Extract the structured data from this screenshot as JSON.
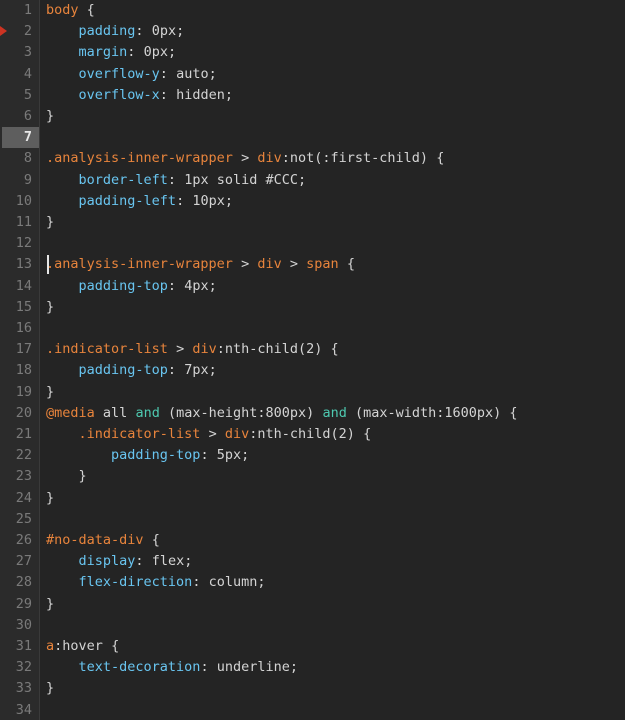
{
  "editor": {
    "language": "CSS",
    "theme": "dark",
    "colors": {
      "background": "#242424",
      "gutter_background": "#2B2B2B",
      "line_number": "#7A7A7A",
      "active_line_number": "#E8E8E8",
      "active_line_highlight": "#5E5E5E",
      "selector": "#E8843C",
      "property": "#69C5F0",
      "value": "#D4D4D4",
      "keyword": "#4EC9B0",
      "breakpoint_marker": "#CC3322",
      "cursor": "#E6E6E6"
    },
    "cursor": {
      "line": 7,
      "column": 1
    },
    "breakpoint_marker_line": 2,
    "total_lines": 34,
    "first_visible_line": 1,
    "lines": [
      {
        "n": 1,
        "tokens": [
          {
            "t": "sel",
            "v": "body"
          },
          {
            "t": "plain",
            "v": " "
          },
          {
            "t": "punc",
            "v": "{"
          }
        ]
      },
      {
        "n": 2,
        "tokens": [
          {
            "t": "plain",
            "v": "    "
          },
          {
            "t": "prop",
            "v": "padding"
          },
          {
            "t": "punc",
            "v": ":"
          },
          {
            "t": "plain",
            "v": " "
          },
          {
            "t": "val",
            "v": "0px"
          },
          {
            "t": "punc",
            "v": ";"
          }
        ]
      },
      {
        "n": 3,
        "tokens": [
          {
            "t": "plain",
            "v": "    "
          },
          {
            "t": "prop",
            "v": "margin"
          },
          {
            "t": "punc",
            "v": ":"
          },
          {
            "t": "plain",
            "v": " "
          },
          {
            "t": "val",
            "v": "0px"
          },
          {
            "t": "punc",
            "v": ";"
          }
        ]
      },
      {
        "n": 4,
        "tokens": [
          {
            "t": "plain",
            "v": "    "
          },
          {
            "t": "prop",
            "v": "overflow-y"
          },
          {
            "t": "punc",
            "v": ":"
          },
          {
            "t": "plain",
            "v": " "
          },
          {
            "t": "val",
            "v": "auto"
          },
          {
            "t": "punc",
            "v": ";"
          }
        ]
      },
      {
        "n": 5,
        "tokens": [
          {
            "t": "plain",
            "v": "    "
          },
          {
            "t": "prop",
            "v": "overflow-x"
          },
          {
            "t": "punc",
            "v": ":"
          },
          {
            "t": "plain",
            "v": " "
          },
          {
            "t": "val",
            "v": "hidden"
          },
          {
            "t": "punc",
            "v": ";"
          }
        ]
      },
      {
        "n": 6,
        "tokens": [
          {
            "t": "punc",
            "v": "}"
          }
        ]
      },
      {
        "n": 7,
        "tokens": []
      },
      {
        "n": 8,
        "tokens": [
          {
            "t": "sel",
            "v": ".analysis-inner-wrapper"
          },
          {
            "t": "plain",
            "v": " "
          },
          {
            "t": "comb",
            "v": ">"
          },
          {
            "t": "plain",
            "v": " "
          },
          {
            "t": "sel",
            "v": "div"
          },
          {
            "t": "pseudo",
            "v": ":not(:first-child)"
          },
          {
            "t": "plain",
            "v": " "
          },
          {
            "t": "punc",
            "v": "{"
          }
        ]
      },
      {
        "n": 9,
        "tokens": [
          {
            "t": "plain",
            "v": "    "
          },
          {
            "t": "prop",
            "v": "border-left"
          },
          {
            "t": "punc",
            "v": ":"
          },
          {
            "t": "plain",
            "v": " "
          },
          {
            "t": "val",
            "v": "1px solid #CCC"
          },
          {
            "t": "punc",
            "v": ";"
          }
        ]
      },
      {
        "n": 10,
        "tokens": [
          {
            "t": "plain",
            "v": "    "
          },
          {
            "t": "prop",
            "v": "padding-left"
          },
          {
            "t": "punc",
            "v": ":"
          },
          {
            "t": "plain",
            "v": " "
          },
          {
            "t": "val",
            "v": "10px"
          },
          {
            "t": "punc",
            "v": ";"
          }
        ]
      },
      {
        "n": 11,
        "tokens": [
          {
            "t": "punc",
            "v": "}"
          }
        ]
      },
      {
        "n": 12,
        "tokens": []
      },
      {
        "n": 13,
        "tokens": [
          {
            "t": "sel",
            "v": ".analysis-inner-wrapper"
          },
          {
            "t": "plain",
            "v": " "
          },
          {
            "t": "comb",
            "v": ">"
          },
          {
            "t": "plain",
            "v": " "
          },
          {
            "t": "sel",
            "v": "div"
          },
          {
            "t": "plain",
            "v": " "
          },
          {
            "t": "comb",
            "v": ">"
          },
          {
            "t": "plain",
            "v": " "
          },
          {
            "t": "sel",
            "v": "span"
          },
          {
            "t": "plain",
            "v": " "
          },
          {
            "t": "punc",
            "v": "{"
          }
        ]
      },
      {
        "n": 14,
        "tokens": [
          {
            "t": "plain",
            "v": "    "
          },
          {
            "t": "prop",
            "v": "padding-top"
          },
          {
            "t": "punc",
            "v": ":"
          },
          {
            "t": "plain",
            "v": " "
          },
          {
            "t": "val",
            "v": "4px"
          },
          {
            "t": "punc",
            "v": ";"
          }
        ]
      },
      {
        "n": 15,
        "tokens": [
          {
            "t": "punc",
            "v": "}"
          }
        ]
      },
      {
        "n": 16,
        "tokens": []
      },
      {
        "n": 17,
        "tokens": [
          {
            "t": "sel",
            "v": ".indicator-list"
          },
          {
            "t": "plain",
            "v": " "
          },
          {
            "t": "comb",
            "v": ">"
          },
          {
            "t": "plain",
            "v": " "
          },
          {
            "t": "sel",
            "v": "div"
          },
          {
            "t": "pseudo",
            "v": ":nth-child(2)"
          },
          {
            "t": "plain",
            "v": " "
          },
          {
            "t": "punc",
            "v": "{"
          }
        ]
      },
      {
        "n": 18,
        "tokens": [
          {
            "t": "plain",
            "v": "    "
          },
          {
            "t": "prop",
            "v": "padding-top"
          },
          {
            "t": "punc",
            "v": ":"
          },
          {
            "t": "plain",
            "v": " "
          },
          {
            "t": "val",
            "v": "7px"
          },
          {
            "t": "punc",
            "v": ";"
          }
        ]
      },
      {
        "n": 19,
        "tokens": [
          {
            "t": "punc",
            "v": "}"
          }
        ]
      },
      {
        "n": 20,
        "tokens": [
          {
            "t": "sel",
            "v": "@media"
          },
          {
            "t": "plain",
            "v": " "
          },
          {
            "t": "val",
            "v": "all"
          },
          {
            "t": "plain",
            "v": " "
          },
          {
            "t": "kw",
            "v": "and"
          },
          {
            "t": "plain",
            "v": " "
          },
          {
            "t": "val",
            "v": "(max-height:800px)"
          },
          {
            "t": "plain",
            "v": " "
          },
          {
            "t": "kw",
            "v": "and"
          },
          {
            "t": "plain",
            "v": " "
          },
          {
            "t": "val",
            "v": "(max-width:1600px)"
          },
          {
            "t": "plain",
            "v": " "
          },
          {
            "t": "punc",
            "v": "{"
          }
        ]
      },
      {
        "n": 21,
        "tokens": [
          {
            "t": "plain",
            "v": "    "
          },
          {
            "t": "sel",
            "v": ".indicator-list"
          },
          {
            "t": "plain",
            "v": " "
          },
          {
            "t": "comb",
            "v": ">"
          },
          {
            "t": "plain",
            "v": " "
          },
          {
            "t": "sel",
            "v": "div"
          },
          {
            "t": "pseudo",
            "v": ":nth-child(2)"
          },
          {
            "t": "plain",
            "v": " "
          },
          {
            "t": "punc",
            "v": "{"
          }
        ]
      },
      {
        "n": 22,
        "tokens": [
          {
            "t": "plain",
            "v": "        "
          },
          {
            "t": "prop",
            "v": "padding-top"
          },
          {
            "t": "punc",
            "v": ":"
          },
          {
            "t": "plain",
            "v": " "
          },
          {
            "t": "val",
            "v": "5px"
          },
          {
            "t": "punc",
            "v": ";"
          }
        ]
      },
      {
        "n": 23,
        "tokens": [
          {
            "t": "plain",
            "v": "    "
          },
          {
            "t": "punc",
            "v": "}"
          }
        ]
      },
      {
        "n": 24,
        "tokens": [
          {
            "t": "punc",
            "v": "}"
          }
        ]
      },
      {
        "n": 25,
        "tokens": []
      },
      {
        "n": 26,
        "tokens": [
          {
            "t": "sel",
            "v": "#no-data-div"
          },
          {
            "t": "plain",
            "v": " "
          },
          {
            "t": "punc",
            "v": "{"
          }
        ]
      },
      {
        "n": 27,
        "tokens": [
          {
            "t": "plain",
            "v": "    "
          },
          {
            "t": "prop",
            "v": "display"
          },
          {
            "t": "punc",
            "v": ":"
          },
          {
            "t": "plain",
            "v": " "
          },
          {
            "t": "val",
            "v": "flex"
          },
          {
            "t": "punc",
            "v": ";"
          }
        ]
      },
      {
        "n": 28,
        "tokens": [
          {
            "t": "plain",
            "v": "    "
          },
          {
            "t": "prop",
            "v": "flex-direction"
          },
          {
            "t": "punc",
            "v": ":"
          },
          {
            "t": "plain",
            "v": " "
          },
          {
            "t": "val",
            "v": "column"
          },
          {
            "t": "punc",
            "v": ";"
          }
        ]
      },
      {
        "n": 29,
        "tokens": [
          {
            "t": "punc",
            "v": "}"
          }
        ]
      },
      {
        "n": 30,
        "tokens": []
      },
      {
        "n": 31,
        "tokens": [
          {
            "t": "sel",
            "v": "a"
          },
          {
            "t": "pseudo",
            "v": ":hover"
          },
          {
            "t": "plain",
            "v": " "
          },
          {
            "t": "punc",
            "v": "{"
          }
        ]
      },
      {
        "n": 32,
        "tokens": [
          {
            "t": "plain",
            "v": "    "
          },
          {
            "t": "prop",
            "v": "text-decoration"
          },
          {
            "t": "punc",
            "v": ":"
          },
          {
            "t": "plain",
            "v": " "
          },
          {
            "t": "val",
            "v": "underline"
          },
          {
            "t": "punc",
            "v": ";"
          }
        ]
      },
      {
        "n": 33,
        "tokens": [
          {
            "t": "punc",
            "v": "}"
          }
        ]
      },
      {
        "n": 34,
        "tokens": []
      }
    ]
  }
}
